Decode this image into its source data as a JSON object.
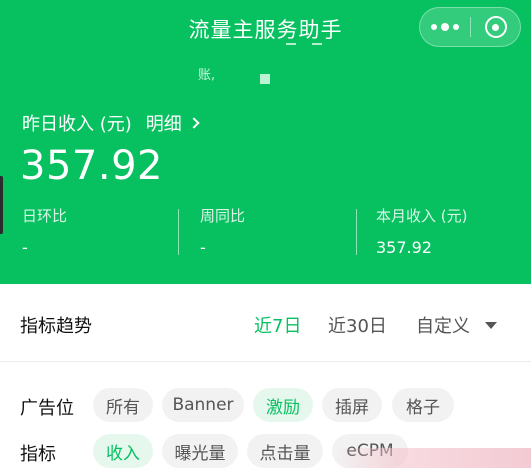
{
  "header": {
    "title": "流量主服务助手",
    "account_hint": "账,",
    "income_label": "昨日收入 (元)",
    "detail_label": "明细",
    "income_value": "357.92",
    "stats": [
      {
        "label": "日环比",
        "value": "-"
      },
      {
        "label": "周同比",
        "value": "-"
      },
      {
        "label": "本月收入 (元)",
        "value": "357.92"
      }
    ],
    "bg_color": "#07c160"
  },
  "trend": {
    "title": "指标趋势",
    "ranges": [
      {
        "label": "近7日",
        "active": true
      },
      {
        "label": "近30日",
        "active": false
      },
      {
        "label": "自定义",
        "active": false
      }
    ],
    "ad_position": {
      "label": "广告位",
      "options": [
        {
          "label": "所有",
          "active": false
        },
        {
          "label": "Banner",
          "active": false
        },
        {
          "label": "激励",
          "active": true
        },
        {
          "label": "插屏",
          "active": false
        },
        {
          "label": "格子",
          "active": false
        }
      ]
    },
    "metric": {
      "label": "指标",
      "options": [
        {
          "label": "收入",
          "active": true
        },
        {
          "label": "曝光量",
          "active": false
        },
        {
          "label": "点击量",
          "active": false
        },
        {
          "label": "eCPM",
          "active": false
        }
      ]
    },
    "accent_color": "#07c160"
  },
  "icons": [
    "more-icon",
    "close-icon",
    "chevron-right-icon",
    "caret-down-icon"
  ]
}
